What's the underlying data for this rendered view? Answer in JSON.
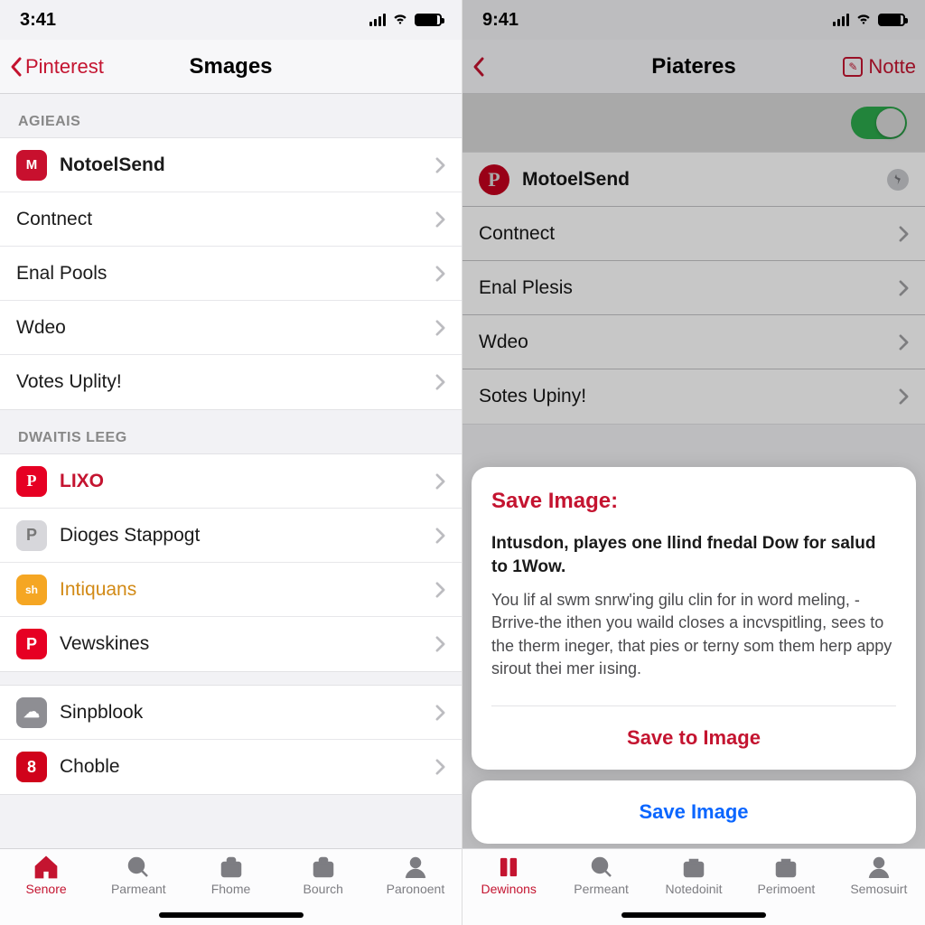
{
  "left": {
    "status_time": "3:41",
    "nav_back": "Pinterest",
    "nav_title": "Smages",
    "section1": "AGIEAIS",
    "rows1": [
      {
        "label": "NotoelSend",
        "icon": "M"
      },
      {
        "label": "Contnect"
      },
      {
        "label": "Enal Pools"
      },
      {
        "label": "Wdeo"
      },
      {
        "label": "Votes Uplity!"
      }
    ],
    "section2": "DWAITIS LEEG",
    "rows2": [
      {
        "label": "LIXO",
        "glyph": "P",
        "cls": "ic-pink",
        "style": "red-text"
      },
      {
        "label": "Dioges Stappogt",
        "glyph": "P",
        "cls": "ic-grey",
        "gstyle": "color:#777"
      },
      {
        "label": "Intiquans",
        "glyph": "sh",
        "cls": "ic-orange",
        "style": "orange-text"
      },
      {
        "label": "Vewskines",
        "glyph": "P",
        "cls": "ic-prnd"
      }
    ],
    "rows3": [
      {
        "label": "Sinpblook",
        "glyph": "☁",
        "cls": "ic-cloud"
      },
      {
        "label": "Choble",
        "glyph": "8",
        "cls": "ic-redsq"
      }
    ],
    "tabs": [
      "Senore",
      "Parmeant",
      "Fhome",
      "Bourch",
      "Paronoent"
    ]
  },
  "right": {
    "status_time": "9:41",
    "nav_title": "Piateres",
    "nav_action": "Notte",
    "rows1": [
      {
        "label": "MotoelSend",
        "pin": true
      },
      {
        "label": "Contnect"
      },
      {
        "label": "Enal Plesis"
      },
      {
        "label": "Wdeo"
      },
      {
        "label": "Sotes Upiny!"
      }
    ],
    "sheet": {
      "title": "Save Image:",
      "strong": "Intusdon, playes one llind fnedal Dow for salud to 1Wow.",
      "body": "You lif al swm snrw'ing gilu clin for in word meling, - Brrive-the ithen you waild closes a incvspitling, sees to the therm ineger, that pies or terny som them herp appy sirout thei mer iısing.",
      "action1": "Save to Image",
      "action2": "Save Image"
    },
    "tabs": [
      "Dewinons",
      "Permeant",
      "Notedoinit",
      "Perimoent",
      "Semosuirt"
    ]
  }
}
